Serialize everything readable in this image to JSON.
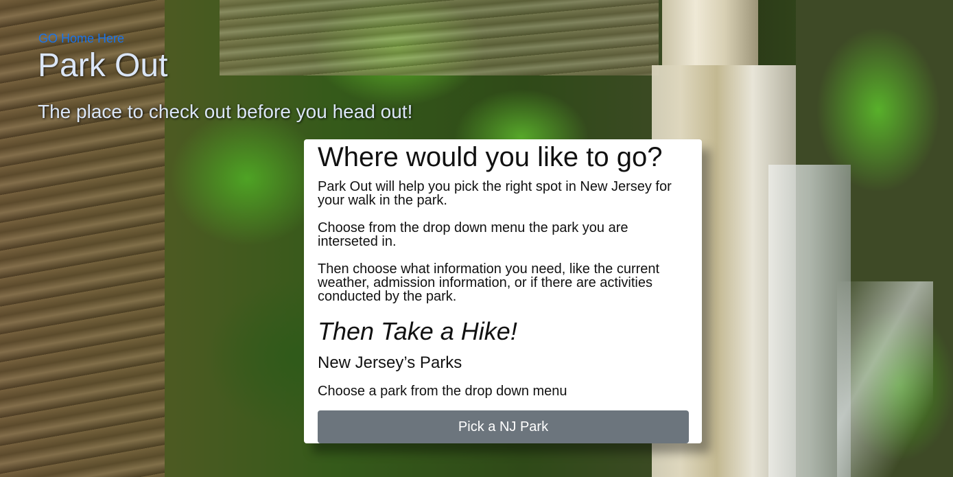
{
  "nav": {
    "home_link": "GO Home Here"
  },
  "hero": {
    "title": "Park Out",
    "tagline": "The place to check out before you head out!"
  },
  "card": {
    "heading": "Where would you like to go?",
    "paragraphs": [
      "Park Out will help you pick the right spot in New Jersey for your walk in the park.",
      "Choose from the drop down menu the park you are interseted in.",
      "Then choose what information you need, like the current weather, admission information, or if there are activities conducted by the park."
    ],
    "hike_heading": "Then Take a Hike!",
    "parks_heading": "New Jersey’s Parks",
    "instruction": "Choose a park from the drop down menu",
    "button_label": "Pick a NJ Park"
  },
  "colors": {
    "link": "#1a73e8",
    "button_bg": "#6c757d",
    "hero_text": "#dbe6f7"
  }
}
